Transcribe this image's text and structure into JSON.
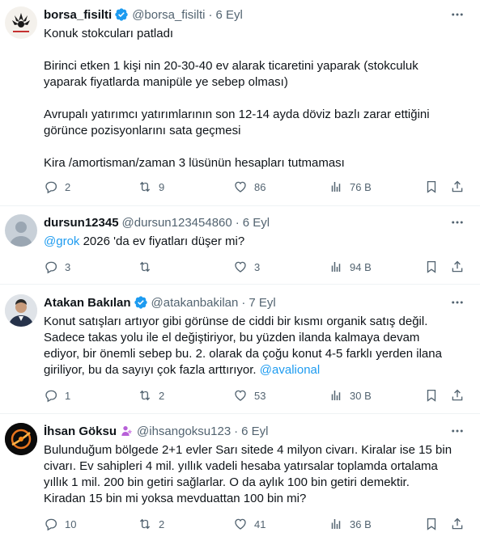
{
  "colors": {
    "accent": "#1d9bf0",
    "muted": "#536471",
    "text": "#0f1419",
    "verified": "#1d9bf0",
    "purple_badge": "#b760d8"
  },
  "tweets": [
    {
      "name": "borsa_fisilti",
      "handle": "@borsa_fisilti",
      "dot": "·",
      "date": "6 Eyl",
      "verified": true,
      "lines": [
        "Konuk stokcuları patladı",
        "",
        "Birinci etken 1 kişi nin 20-30-40 ev alarak ticaretini yaparak (stokculuk",
        "yaparak fiyatlarda manipüle ye sebep olması)",
        "",
        "Avrupalı yatırımcı yatırımlarının son 12-14 ayda döviz bazlı zarar ettiğini",
        "görünce pozisyonlarını sata geçmesi",
        "",
        "Kira /amortisman/zaman 3 lüsünün hesapları tutmaması"
      ],
      "replies": "2",
      "retweets": "9",
      "likes": "86",
      "views": "76 B"
    },
    {
      "name": "dursun12345",
      "handle": "@dursun123454860",
      "dot": "·",
      "date": "6 Eyl",
      "verified": false,
      "mention": "@grok",
      "text": " 2026 'da ev fiyatları düşer mi?",
      "replies": "3",
      "retweets": "",
      "likes": "3",
      "views": "94 B"
    },
    {
      "name": "Atakan Bakılan",
      "handle": "@atakanbakilan",
      "dot": "·",
      "date": "7 Eyl",
      "verified": true,
      "lines": [
        "Konut satışları artıyor gibi görünse de ciddi bir kısmı organik satış değil.",
        "Sadece takas yolu ile el değiştiriyor, bu yüzden ilanda kalmaya devam",
        "ediyor, bir önemli sebep bu. 2. olarak da çoğu konut 4-5 farklı yerden ilana",
        "giriliyor, bu da sayıyı çok fazla arttırıyor."
      ],
      "mention": "@avalional",
      "replies": "1",
      "retweets": "2",
      "likes": "53",
      "views": "30 B"
    },
    {
      "name": "İhsan Göksu",
      "handle": "@ihsangoksu123",
      "dot": "·",
      "date": "6 Eyl",
      "verified": false,
      "lines": [
        "Bulunduğum bölgede 2+1 evler Sarı sitede 4 milyon civarı. Kiralar ise 15 bin",
        "civarı. Ev sahipleri 4 mil. yıllık vadeli hesaba yatırsalar toplamda ortalama",
        "yıllık 1 mil. 200 bin getiri sağlarlar. O da aylık 100 bin getiri demektir.",
        "Kiradan 15 bin mi yoksa mevduattan 100 bin mi?"
      ],
      "replies": "10",
      "retweets": "2",
      "likes": "41",
      "views": "36 B"
    }
  ]
}
